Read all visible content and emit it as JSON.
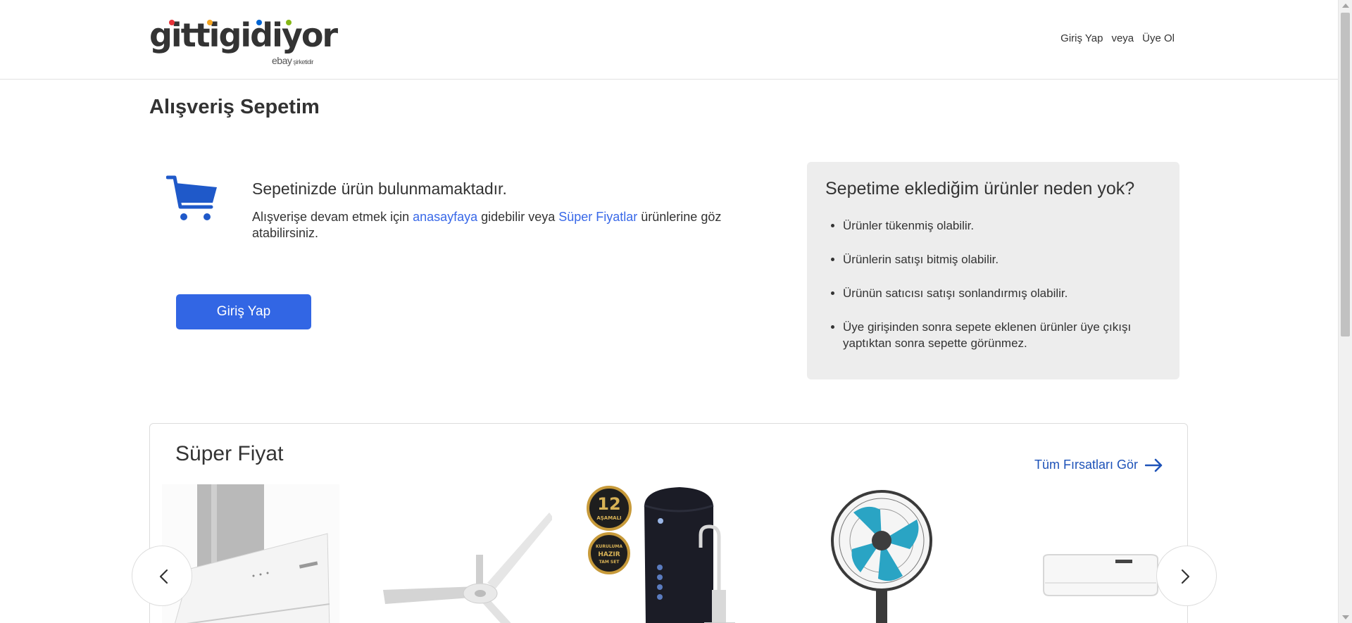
{
  "header": {
    "logo_text": "gittigidiyor",
    "logo_sub_brand": "ebay",
    "logo_sub_text": "şirketidir",
    "login_link": "Giriş Yap",
    "or_text": "veya",
    "register_link": "Üye Ol"
  },
  "page": {
    "title": "Alışveriş Sepetim"
  },
  "empty_cart": {
    "icon": "shopping-cart-icon",
    "title": "Sepetinizde ürün bulunmamaktadır.",
    "desc_part1": "Alışverişe devam etmek için ",
    "home_link": "anasayfaya",
    "desc_part2": " gidebilir veya ",
    "super_link": "Süper Fiyatlar",
    "desc_part3": " ürünlerine göz atabilirsiniz.",
    "login_button": "Giriş Yap"
  },
  "why_box": {
    "title": "Sepetime eklediğim ürünler neden yok?",
    "items": [
      "Ürünler tükenmiş olabilir.",
      "Ürünlerin satışı bitmiş olabilir.",
      "Ürünün satıcısı satışı sonlandırmış olabilir.",
      "Üye girişinden sonra sepete eklenen ürünler üye çıkışı yaptıktan sonra sepette görünmez."
    ]
  },
  "super_price": {
    "title": "Süper Fiyat",
    "see_all": "Tüm Fırsatları Gör",
    "badge_top_number": "12",
    "badge_top_text": "AŞAMALI",
    "badge_bottom_lines": [
      "KURULUMA",
      "HAZIR",
      "TAM SET"
    ],
    "products": [
      {
        "name": "kitchen-hood"
      },
      {
        "name": "ceiling-fan"
      },
      {
        "name": "water-purifier"
      },
      {
        "name": "desk-fan"
      },
      {
        "name": "air-conditioner"
      }
    ]
  },
  "colors": {
    "primary_button": "#3266e4",
    "link": "#3868e8",
    "see_all": "#1d52b8",
    "cart_icon": "#1f59c9",
    "info_box_bg": "#ededed"
  }
}
